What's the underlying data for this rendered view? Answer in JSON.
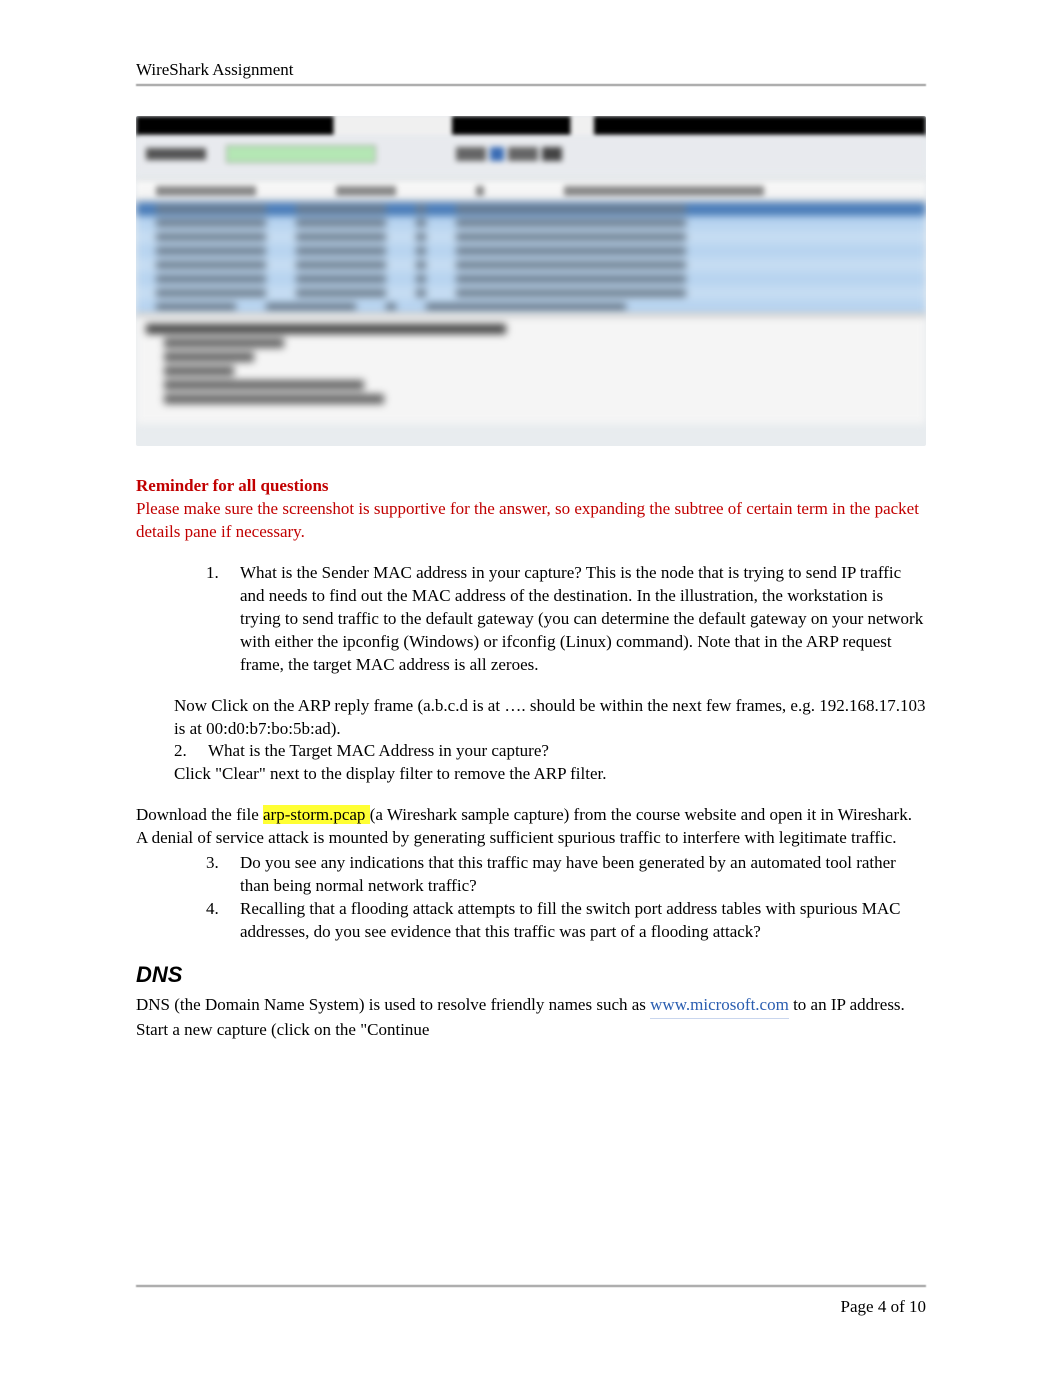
{
  "header": {
    "title": "WireShark Assignment"
  },
  "reminder": {
    "heading": "Reminder for all questions",
    "body": "Please make sure the screenshot is supportive for the answer, so expanding the subtree of certain term in the packet details pane if necessary."
  },
  "q1": {
    "num": "1.",
    "text": "What is the Sender MAC address in your capture?  This is the node that is trying to send IP traffic and needs to find out the MAC address of the destination.  In the illustration, the workstation is trying to send traffic to the default gateway (you can determine the default gateway on your network with either the ipconfig (Windows) or ifconfig (Linux) command).  Note that in the ARP request frame, the target MAC address is all zeroes."
  },
  "arp_reply_note": "Now Click on the ARP reply frame (a.b.c.d is at …. should be within the next few frames, e.g. 192.168.17.103 is at 00:d0:b7:bo:5b:ad).",
  "q2": {
    "num": "2.",
    "text": "What is the Target MAC Address in your capture?"
  },
  "clear_note": "Click \"Clear\" next to the display filter to remove the ARP filter.",
  "download_pre": "Download the file ",
  "download_highlight": "arp-storm.pcap ",
  "download_post": "(a Wireshark sample capture) from the course website and open it in Wireshark.  A denial of service attack is mounted by generating sufficient spurious traffic to interfere with legitimate traffic.",
  "q3": {
    "num": "3.",
    "text": "Do you see any indications that this traffic may have been generated by an automated tool rather than being normal network traffic?"
  },
  "q4": {
    "num": "4.",
    "text": "Recalling that a flooding attack attempts to fill the switch port address tables with spurious MAC addresses, do you see evidence that this traffic was part of a flooding attack?"
  },
  "dns": {
    "heading": "DNS",
    "body_pre": "DNS (the Domain Name System) is used to resolve friendly names such as ",
    "link_text": "www.microsoft.com",
    "body_post": " to an IP address.  Start a new capture (click on the \"Continue"
  },
  "footer": {
    "page": "Page 4 of 10"
  }
}
